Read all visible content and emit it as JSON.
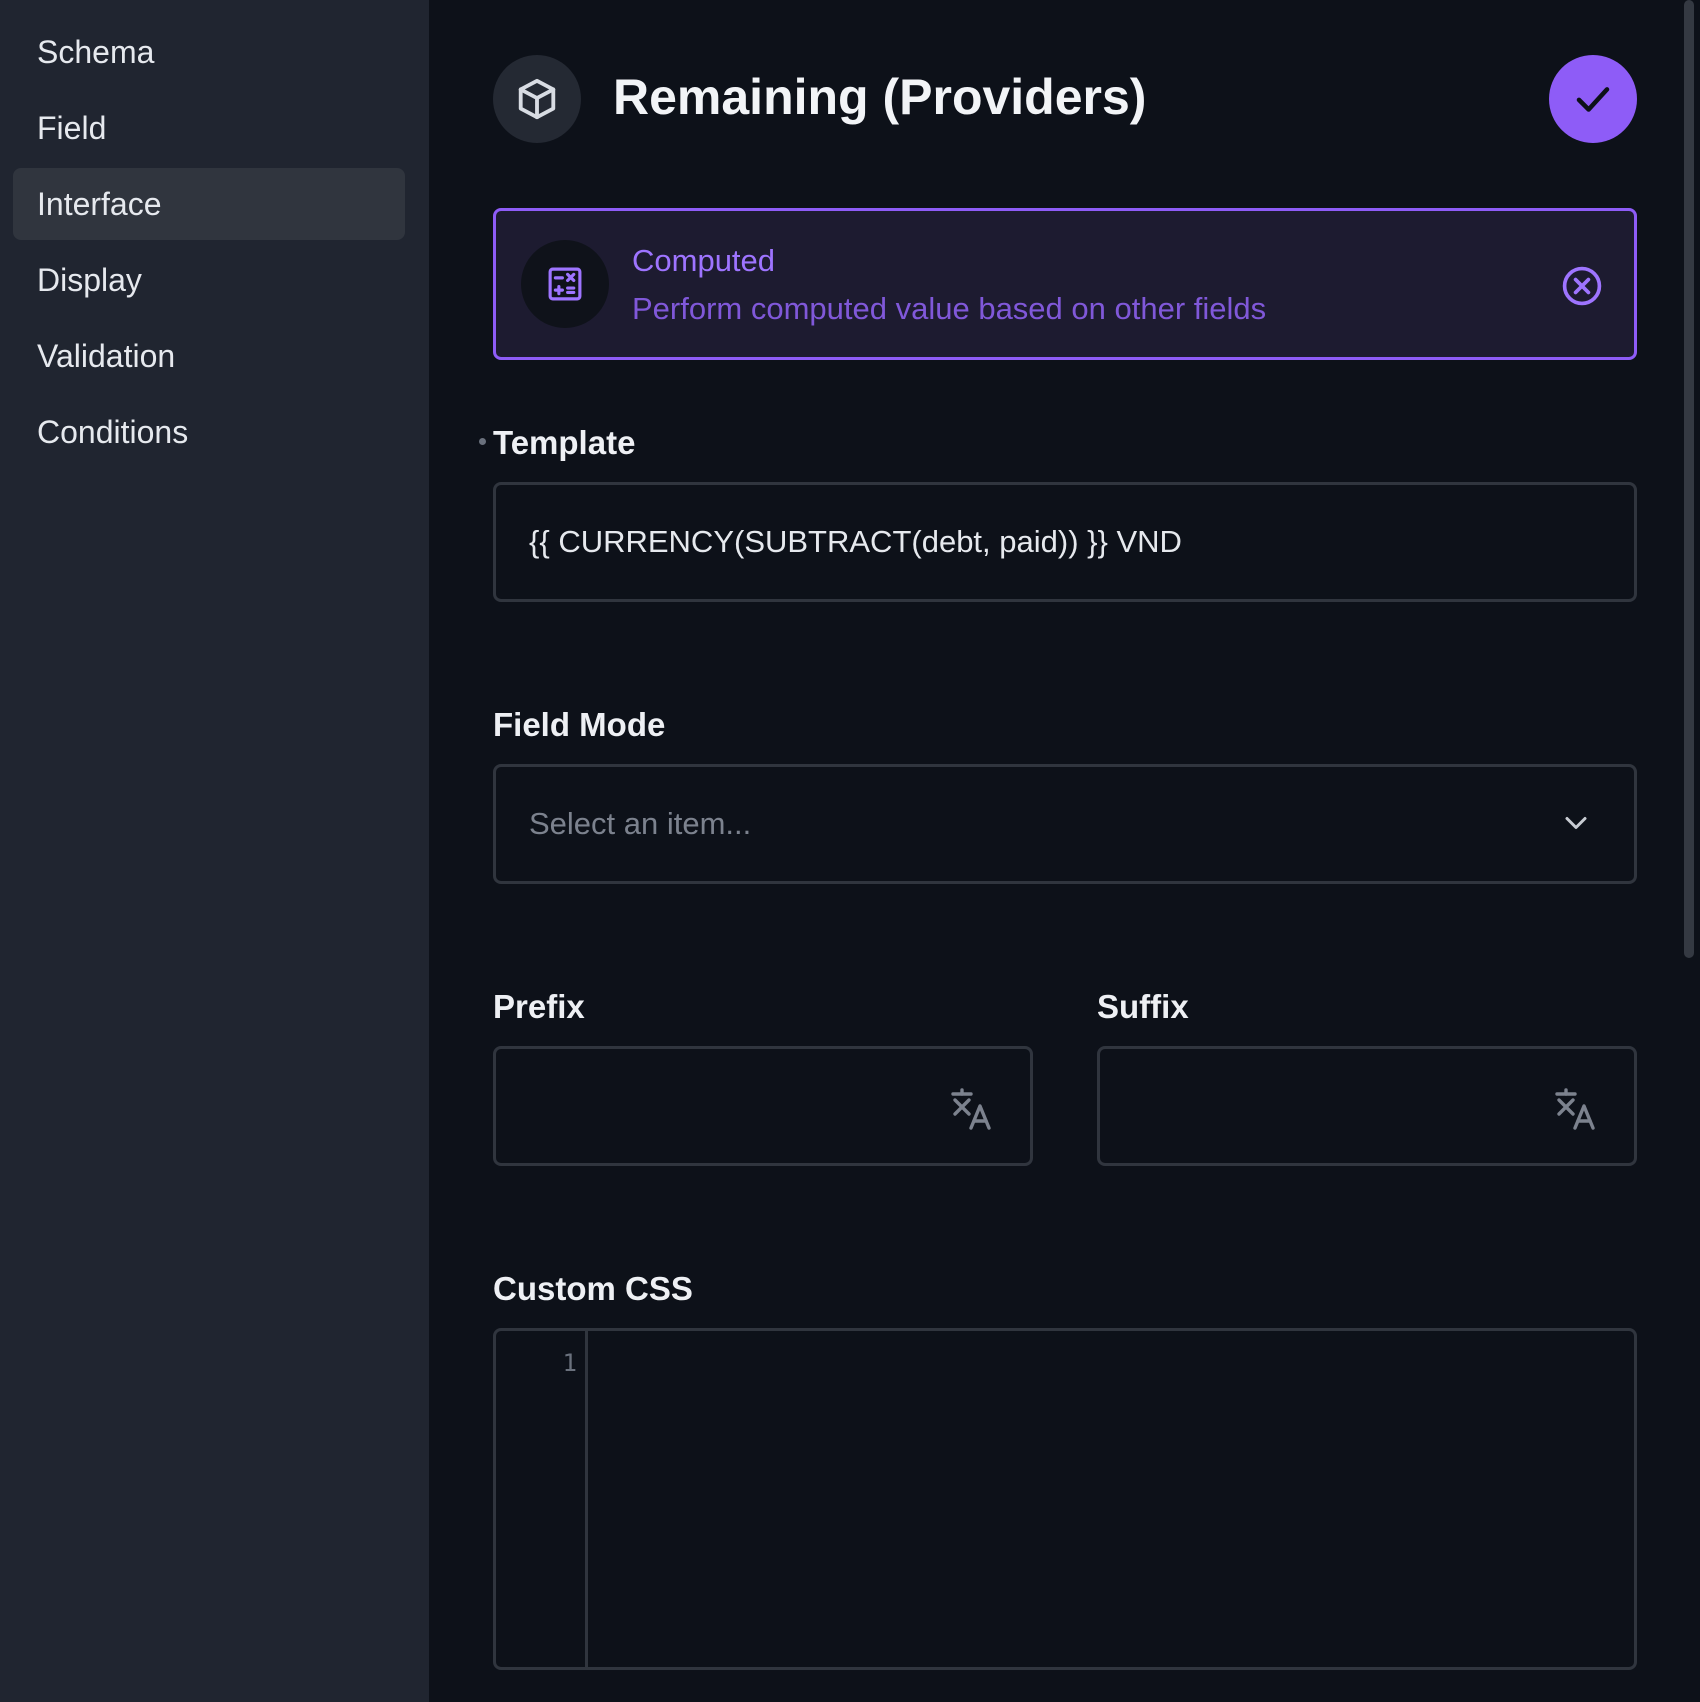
{
  "sidebar": {
    "items": [
      {
        "label": "Schema",
        "active": false
      },
      {
        "label": "Field",
        "active": false
      },
      {
        "label": "Interface",
        "active": true
      },
      {
        "label": "Display",
        "active": false
      },
      {
        "label": "Validation",
        "active": false
      },
      {
        "label": "Conditions",
        "active": false
      }
    ]
  },
  "header": {
    "title": "Remaining (Providers)",
    "icon": "cube-icon",
    "confirm_icon": "check-icon"
  },
  "interface_card": {
    "title": "Computed",
    "description": "Perform computed value based on other fields",
    "icon": "calculator-icon",
    "close_icon": "close-circle-icon"
  },
  "template": {
    "label": "Template",
    "value": "{{ CURRENCY(SUBTRACT(debt, paid)) }} VND",
    "required": true
  },
  "field_mode": {
    "label": "Field Mode",
    "placeholder": "Select an item..."
  },
  "prefix": {
    "label": "Prefix",
    "value": ""
  },
  "suffix": {
    "label": "Suffix",
    "value": ""
  },
  "custom_css": {
    "label": "Custom CSS",
    "line_numbers": [
      "1"
    ]
  },
  "colors": {
    "accent": "#8e5cf7",
    "background": "#0d1119",
    "sidebar": "#202530"
  }
}
